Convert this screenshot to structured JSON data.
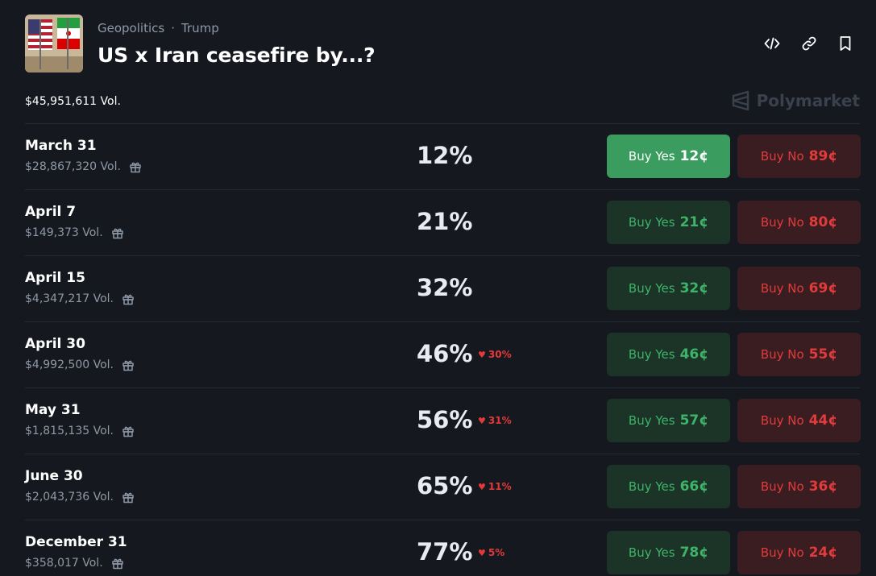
{
  "header": {
    "category": "Geopolitics",
    "separator": "·",
    "subcategory": "Trump",
    "title": "US x Iran ceasefire by...?",
    "thumbnail_icon": "us-iran-flags-icon",
    "actions": [
      {
        "icon": "embed-code-icon"
      },
      {
        "icon": "link-icon"
      },
      {
        "icon": "bookmark-icon"
      }
    ]
  },
  "market": {
    "total_volume": "$45,951,611 Vol.",
    "brand": "Polymarket"
  },
  "colors": {
    "background": "#15191f",
    "yes_green": "#3db468",
    "yes_active_bg": "#3a9d5f",
    "no_red": "#e23b3b",
    "change_red": "#e23939"
  },
  "outcomes": [
    {
      "date": "March 31",
      "volume": "$28,867,320 Vol.",
      "probability": "12%",
      "change": "",
      "yes_label": "Buy Yes",
      "yes_price": "12¢",
      "no_label": "Buy No",
      "no_price": "89¢",
      "yes_active": true
    },
    {
      "date": "April 7",
      "volume": "$149,373 Vol.",
      "probability": "21%",
      "change": "",
      "yes_label": "Buy Yes",
      "yes_price": "21¢",
      "no_label": "Buy No",
      "no_price": "80¢",
      "yes_active": false
    },
    {
      "date": "April 15",
      "volume": "$4,347,217 Vol.",
      "probability": "32%",
      "change": "",
      "yes_label": "Buy Yes",
      "yes_price": "32¢",
      "no_label": "Buy No",
      "no_price": "69¢",
      "yes_active": false
    },
    {
      "date": "April 30",
      "volume": "$4,992,500 Vol.",
      "probability": "46%",
      "change": "30%",
      "yes_label": "Buy Yes",
      "yes_price": "46¢",
      "no_label": "Buy No",
      "no_price": "55¢",
      "yes_active": false
    },
    {
      "date": "May 31",
      "volume": "$1,815,135 Vol.",
      "probability": "56%",
      "change": "31%",
      "yes_label": "Buy Yes",
      "yes_price": "57¢",
      "no_label": "Buy No",
      "no_price": "44¢",
      "yes_active": false
    },
    {
      "date": "June 30",
      "volume": "$2,043,736 Vol.",
      "probability": "65%",
      "change": "11%",
      "yes_label": "Buy Yes",
      "yes_price": "66¢",
      "no_label": "Buy No",
      "no_price": "36¢",
      "yes_active": false
    },
    {
      "date": "December 31",
      "volume": "$358,017 Vol.",
      "probability": "77%",
      "change": "5%",
      "yes_label": "Buy Yes",
      "yes_price": "78¢",
      "no_label": "Buy No",
      "no_price": "24¢",
      "yes_active": false
    }
  ]
}
